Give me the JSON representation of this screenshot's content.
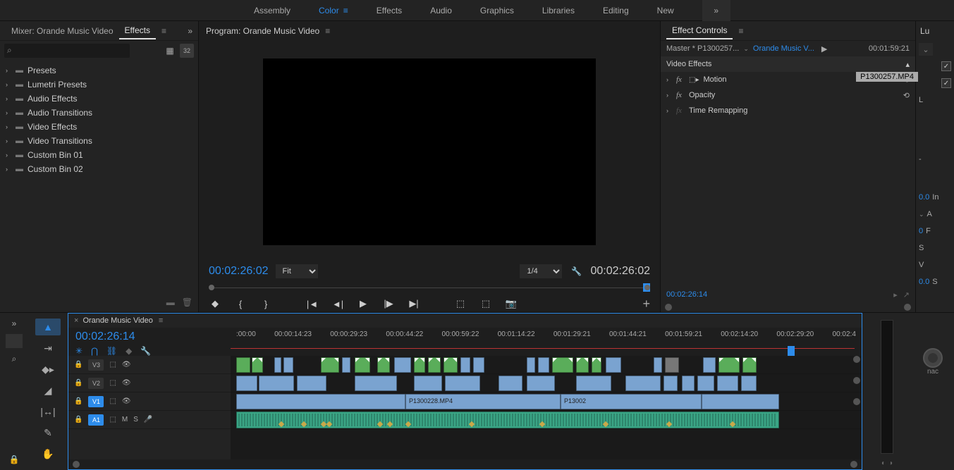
{
  "workspaces": [
    "Assembly",
    "Color",
    "Effects",
    "Audio",
    "Graphics",
    "Libraries",
    "Editing",
    "New"
  ],
  "active_workspace": 1,
  "left_panel": {
    "tab_a": "Mixer: Orande Music Video",
    "tab_b": "Effects",
    "bins": [
      "Presets",
      "Lumetri Presets",
      "Audio Effects",
      "Audio Transitions",
      "Video Effects",
      "Video Transitions",
      "Custom Bin 01",
      "Custom Bin 02"
    ],
    "badge": "32"
  },
  "program": {
    "title": "Program: Orande Music Video",
    "tc_left": "00:02:26:02",
    "tc_right": "00:02:26:02",
    "zoom": "Fit",
    "res": "1/4"
  },
  "ec": {
    "title": "Effect Controls",
    "master": "Master * P1300257...",
    "seq": "Orande Music V...",
    "head_tc": "00:01:59:21",
    "clip": "P1300257.MP4",
    "section": "Video Effects",
    "rows": [
      {
        "name": "Motion",
        "fx": true,
        "reset": true,
        "extra_icon": true
      },
      {
        "name": "Opacity",
        "fx": true,
        "reset": true
      },
      {
        "name": "Time Remapping",
        "fx": false
      }
    ],
    "foot_tc": "00:02:26:14"
  },
  "lumetri": {
    "title": "Lu",
    "val1": "0.0",
    "val2": "0",
    "rows": [
      "In",
      "A",
      "F",
      "S",
      "V",
      "S"
    ],
    "tag": "nac"
  },
  "timeline": {
    "seq_name": "Orande Music Video",
    "tc": "00:02:26:14",
    "ruler": [
      ":00:00",
      "00:00:14:23",
      "00:00:29:23",
      "00:00:44:22",
      "00:00:59:22",
      "00:01:14:22",
      "00:01:29:21",
      "00:01:44:21",
      "00:01:59:21",
      "00:02:14:20",
      "00:02:29:20",
      "00:02:4"
    ],
    "tracks_v": [
      "V3",
      "V2",
      "V1"
    ],
    "tracks_a": [
      "A1"
    ],
    "clip_label_1": "P1300228.MP4",
    "clip_label_2": "P13002"
  },
  "tools": [
    "V",
    "A",
    "R",
    "S",
    "P",
    "H"
  ],
  "track_mute_labels": {
    "m": "M",
    "s": "S"
  }
}
